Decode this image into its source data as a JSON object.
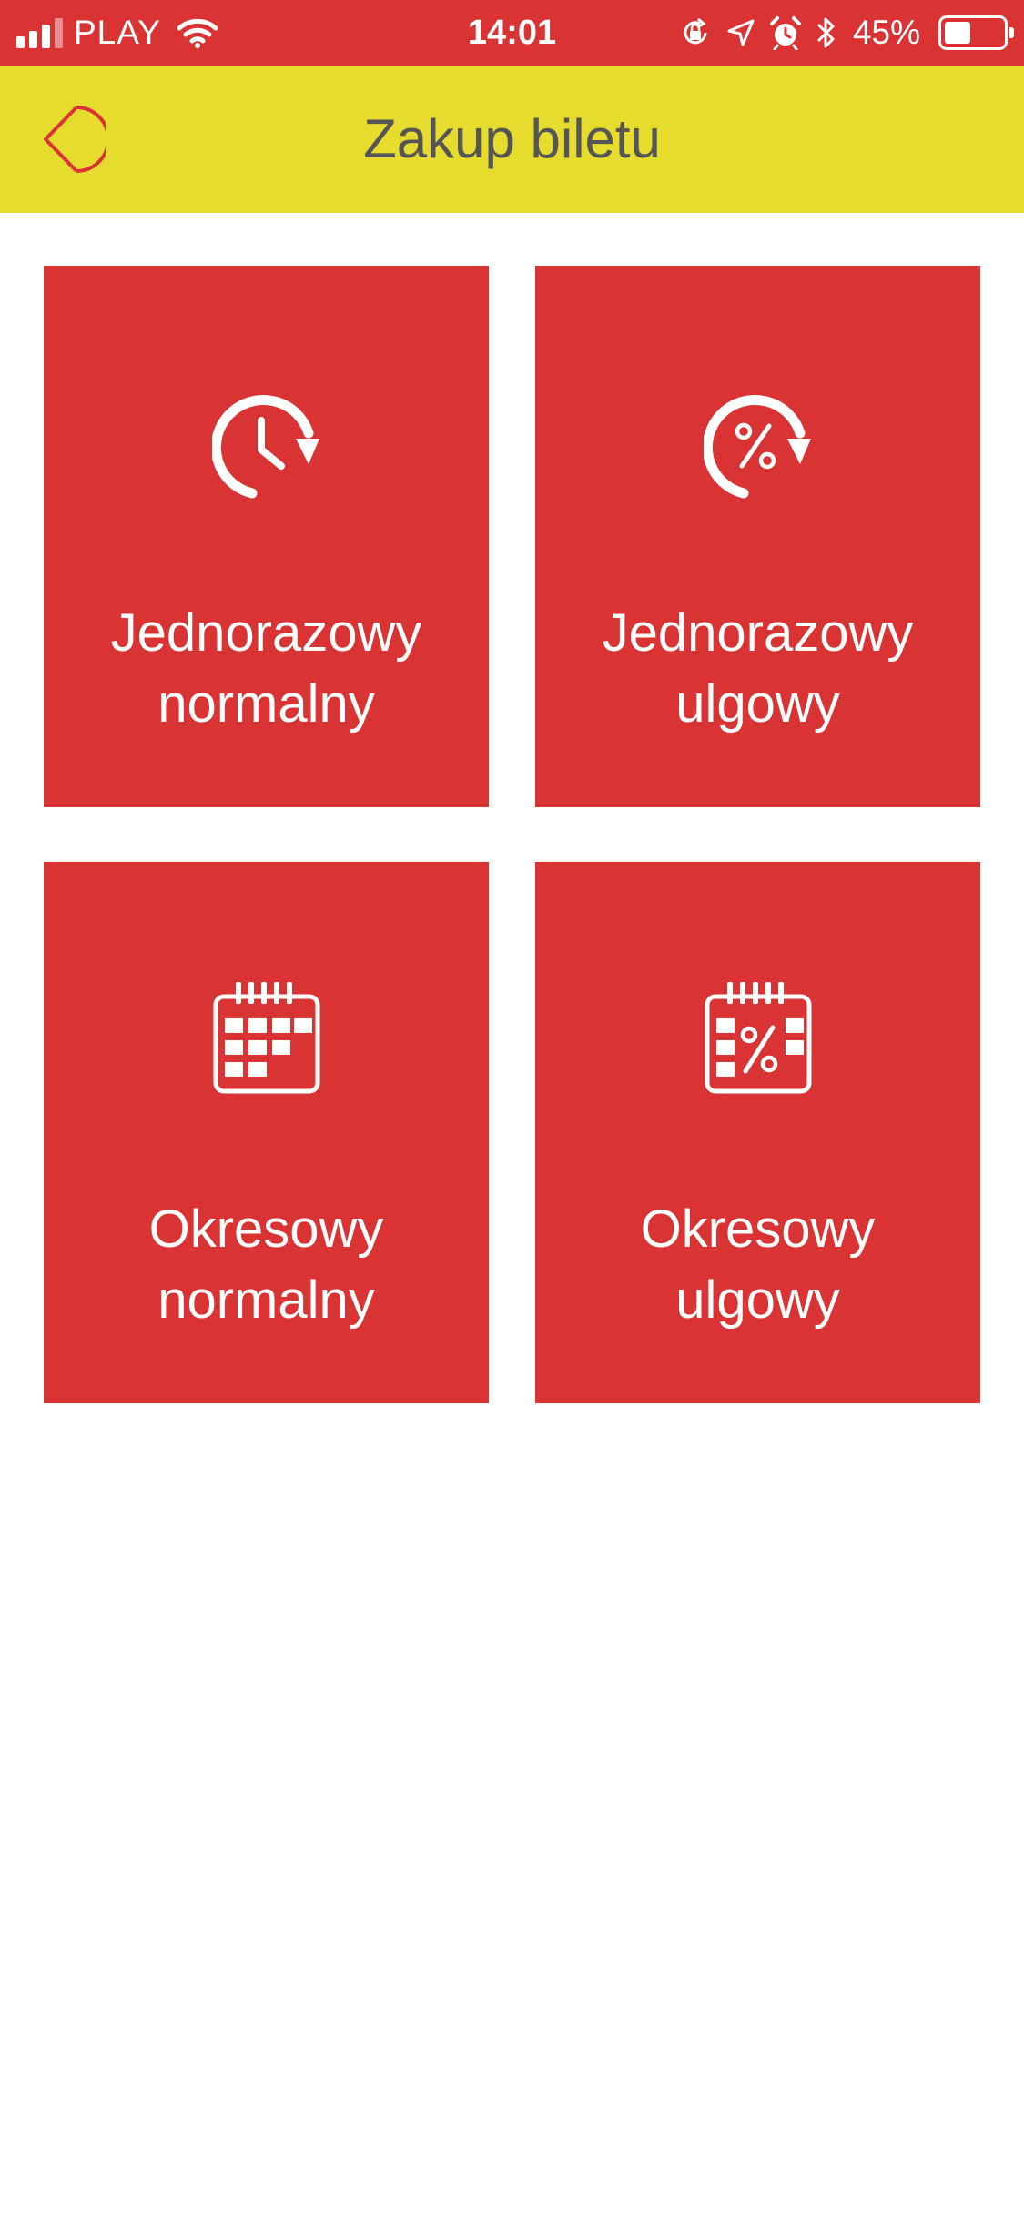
{
  "status_bar": {
    "carrier": "PLAY",
    "time": "14:01",
    "battery_percent": "45%",
    "battery_level": 0.45,
    "icons": [
      "signal-icon",
      "wifi-icon",
      "orientation-lock-icon",
      "location-icon",
      "alarm-icon",
      "bluetooth-icon",
      "battery-icon"
    ]
  },
  "header": {
    "title": "Zakup biletu",
    "back_icon": "back-chevron-circle-icon"
  },
  "tiles": [
    {
      "line1": "Jednorazowy",
      "line2": "normalny",
      "icon": "clock-arrow-icon"
    },
    {
      "line1": "Jednorazowy",
      "line2": "ulgowy",
      "icon": "percent-arrow-icon"
    },
    {
      "line1": "Okresowy",
      "line2": "normalny",
      "icon": "calendar-icon"
    },
    {
      "line1": "Okresowy",
      "line2": "ulgowy",
      "icon": "calendar-percent-icon"
    }
  ],
  "colors": {
    "status_bar": "#d93333",
    "header": "#e6dc2e",
    "tile": "#d93333",
    "title_text": "#555555",
    "back_icon": "#d93333"
  }
}
